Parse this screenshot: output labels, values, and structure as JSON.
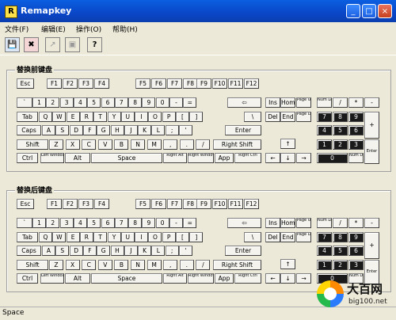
{
  "window": {
    "title": "Remapkey",
    "icon_letter": "R"
  },
  "title_buttons": [
    "_",
    "□",
    "×"
  ],
  "menu": [
    {
      "label": "文件(F)"
    },
    {
      "label": "编辑(E)"
    },
    {
      "label": "操作(O)"
    },
    {
      "label": "帮助(H)"
    }
  ],
  "toolbar_icons": [
    "save-icon",
    "exit-icon",
    "remap-icon",
    "disabled-icon",
    "help-icon"
  ],
  "panels": {
    "before": "替换前键盘",
    "after": "替换后键盘"
  },
  "keyboard": {
    "esc": "Esc",
    "fkeys": [
      "F1",
      "F2",
      "F3",
      "F4",
      "F5",
      "F6",
      "F7",
      "F8",
      "F9",
      "F10",
      "F11",
      "F12"
    ],
    "row1": [
      "`",
      "1",
      "2",
      "3",
      "4",
      "5",
      "6",
      "7",
      "8",
      "9",
      "0",
      "-",
      "=",
      "⇦"
    ],
    "row2": [
      "Tab",
      "Q",
      "W",
      "E",
      "R",
      "T",
      "Y",
      "U",
      "I",
      "O",
      "P",
      "[",
      "]",
      "\\"
    ],
    "row3": [
      "Caps",
      "A",
      "S",
      "D",
      "F",
      "G",
      "H",
      "J",
      "K",
      "L",
      ";",
      "'",
      "Enter"
    ],
    "row4": [
      "Shift",
      "Z",
      "X",
      "C",
      "V",
      "B",
      "N",
      "M",
      ",",
      ".",
      "/",
      "Right Shift"
    ],
    "row5": [
      "Ctrl",
      "Left Windows",
      "Alt",
      "Space",
      "Right Alt",
      "Right Windows",
      "App",
      "Right Ctrl"
    ],
    "nav1": [
      "Ins",
      "Home",
      "Page Up"
    ],
    "nav2": [
      "Del",
      "End",
      "Page Down"
    ],
    "arrows": [
      "↑",
      "←",
      "↓",
      "→"
    ],
    "num1": [
      "Num Lock",
      "/",
      "*",
      "-"
    ],
    "num2": [
      "7",
      "8",
      "9",
      "+"
    ],
    "num3": [
      "4",
      "5",
      "6"
    ],
    "num4": [
      "1",
      "2",
      "3",
      "Enter"
    ],
    "num5": [
      "0",
      "Num Del"
    ]
  },
  "status": {
    "text": "Space"
  },
  "watermark": {
    "name": "大百网",
    "url": "big100.net"
  }
}
